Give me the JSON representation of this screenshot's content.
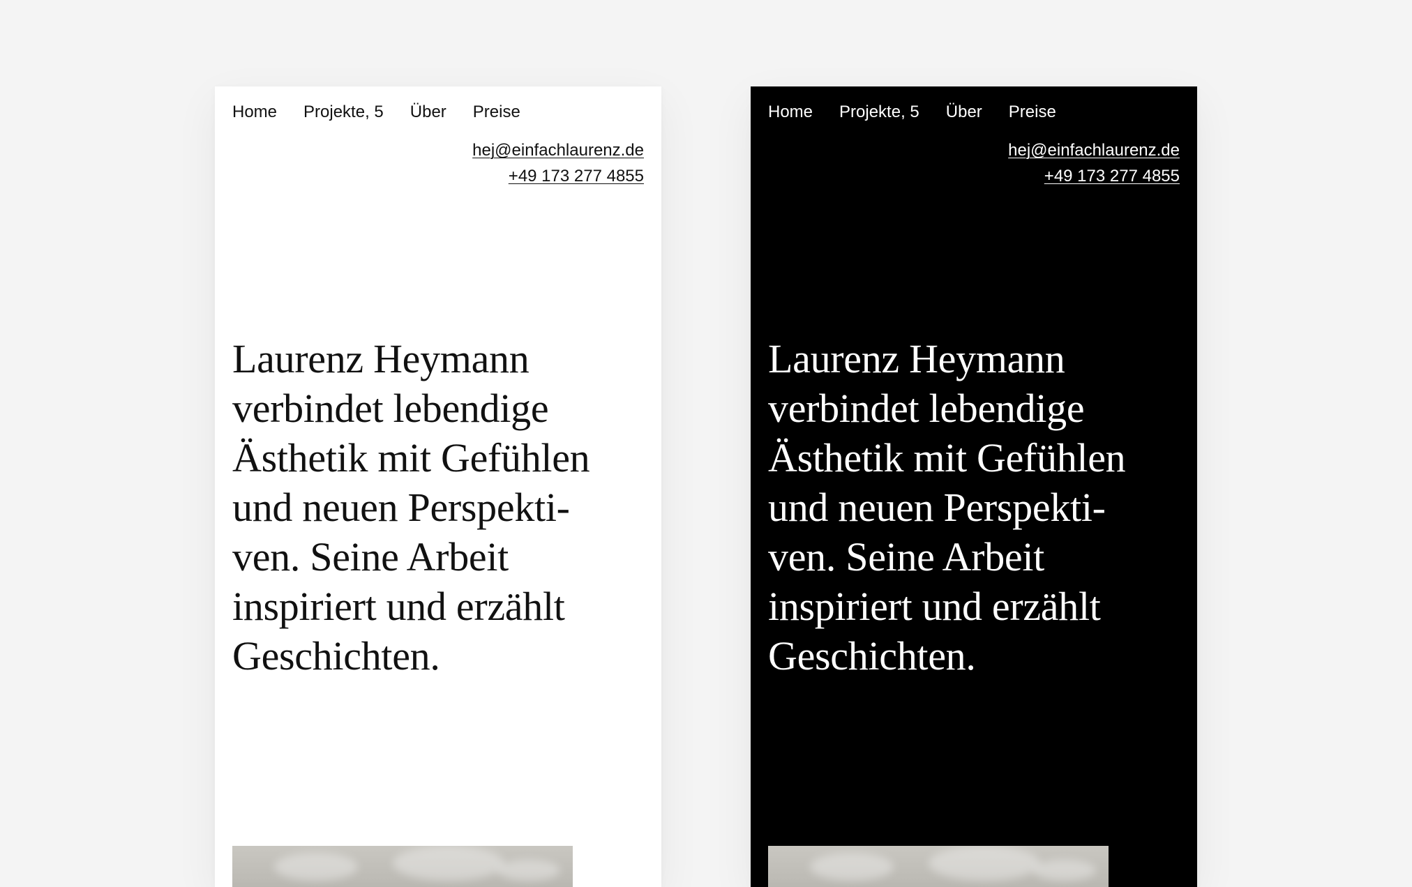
{
  "nav": {
    "items": [
      "Home",
      "Projekte, 5",
      "Über",
      "Preise"
    ]
  },
  "contact": {
    "email": "hej@einfachlaurenz.de",
    "phone": "+49 173 277 4855"
  },
  "intro": {
    "lines": [
      "Laurenz Heymann",
      "verbindet lebendige",
      "Ästhetik mit Gefühlen",
      "und neuen Perspekti-",
      "ven. Seine Arbeit",
      "inspiriert und erzählt",
      "Geschichten."
    ]
  },
  "colors": {
    "background": "#f4f4f4",
    "light_surface": "#ffffff",
    "light_text": "#111111",
    "dark_surface": "#000000",
    "dark_text": "#ffffff"
  }
}
